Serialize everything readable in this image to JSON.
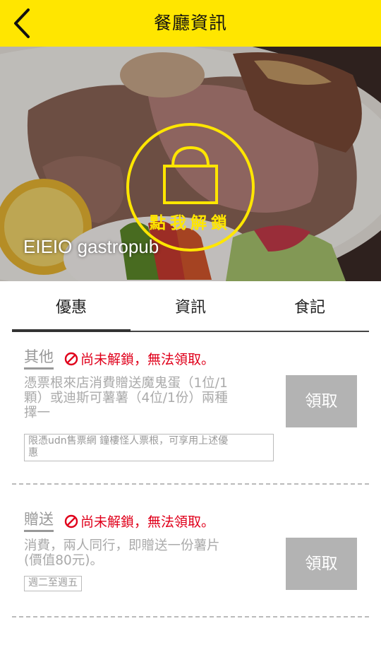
{
  "header": {
    "title": "餐廳資訊",
    "back_icon": "chevron-left-icon"
  },
  "hero": {
    "unlock_label": "點我解鎖",
    "restaurant_name": "EIEIO gastropub",
    "accent_color": "#FFE600"
  },
  "tabs": [
    {
      "label": "優惠",
      "active": true
    },
    {
      "label": "資訊",
      "active": false
    },
    {
      "label": "食記",
      "active": false
    }
  ],
  "coupons": [
    {
      "category": "其他",
      "status": "尚未解鎖，無法領取。",
      "description_lines": [
        "憑票根來店消費贈送魔鬼蛋（1位/1",
        "顆）或迪斯可薯薯（4位/1份）兩種",
        "擇一"
      ],
      "note_lines": [
        "限憑udn售票網 鐘樓怪人票根，可享用上述優",
        "惠"
      ],
      "button": "領取"
    },
    {
      "category": "贈送",
      "status": "尚未解鎖，無法領取。",
      "description_lines": [
        "消費，兩人同行，即贈送一份薯片",
        "(價值80元)。"
      ],
      "note_lines": [
        "週二至週五"
      ],
      "button": "領取"
    }
  ]
}
